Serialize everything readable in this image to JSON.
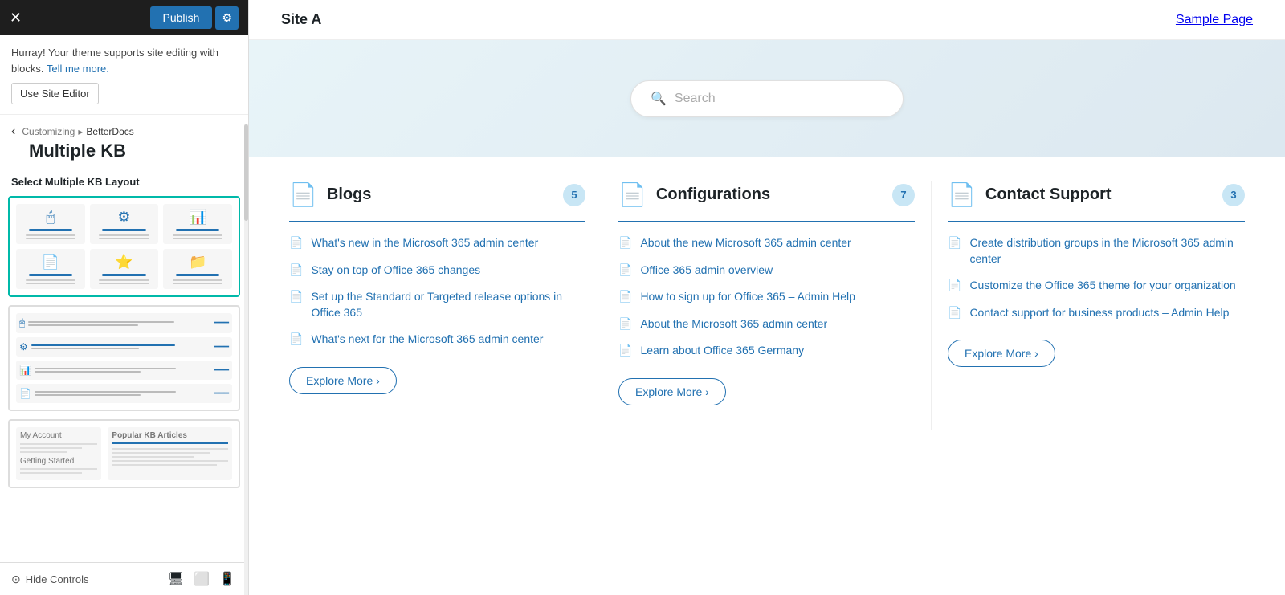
{
  "topBar": {
    "publishLabel": "Publish",
    "gearIcon": "⚙",
    "closeIcon": "✕"
  },
  "notice": {
    "text": "Hurray! Your theme supports site editing with blocks.",
    "linkText": "Tell me more.",
    "buttonLabel": "Use Site Editor"
  },
  "breadcrumb": {
    "backIcon": "‹",
    "customizingLabel": "Customizing",
    "separator": "▸",
    "currentLabel": "BetterDocs"
  },
  "panelTitle": "Multiple KB",
  "sectionLabel": "Select Multiple KB Layout",
  "layouts": [
    {
      "id": "grid",
      "selected": true
    },
    {
      "id": "list",
      "selected": false
    },
    {
      "id": "mixed",
      "selected": false
    }
  ],
  "bottomBar": {
    "hideControlsLabel": "Hide Controls",
    "hideIcon": "⊙",
    "desktopIcon": "🖥",
    "tabletIcon": "▭",
    "mobileIcon": "▯"
  },
  "site": {
    "title": "Site A",
    "navItem": "Sample Page"
  },
  "search": {
    "placeholder": "Search",
    "searchIcon": "🔍"
  },
  "categories": [
    {
      "icon": "📄",
      "title": "Blogs",
      "count": "5",
      "articles": [
        "What's new in the Microsoft 365 admin center",
        "Stay on top of Office 365 changes",
        "Set up the Standard or Targeted release options in Office 365",
        "What's next for the Microsoft 365 admin center"
      ],
      "exploreMore": "Explore More",
      "exploreIcon": "›"
    },
    {
      "icon": "📄",
      "title": "Configurations",
      "count": "7",
      "articles": [
        "About the new Microsoft 365 admin center",
        "Office 365 admin overview",
        "How to sign up for Office 365 – Admin Help",
        "About the Microsoft 365 admin center",
        "Learn about Office 365 Germany"
      ],
      "exploreMore": "Explore More",
      "exploreIcon": "›"
    },
    {
      "icon": "📄",
      "title": "Contact Support",
      "count": "3",
      "articles": [
        "Create distribution groups in the Microsoft 365 admin center",
        "Customize the Office 365 theme for your organization",
        "Contact support for business products – Admin Help"
      ],
      "exploreMore": "Explore More",
      "exploreIcon": "›"
    }
  ]
}
